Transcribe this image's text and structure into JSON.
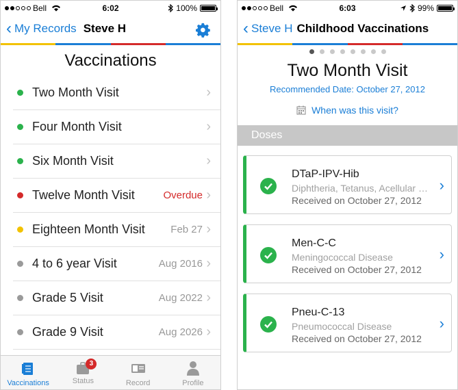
{
  "colors": {
    "accent": "#1a7ed6",
    "done": "#2bb24c",
    "overdue": "#d42a2a",
    "upcoming": "#f2c200",
    "future": "#9a9a9a",
    "stripe": [
      "#f2c200",
      "#1a7ed6",
      "#d42a2a",
      "#1a7ed6"
    ]
  },
  "left": {
    "status_bar": {
      "carrier": "Bell",
      "time": "6:02",
      "battery": "100%",
      "battery_level": 1.0
    },
    "nav": {
      "back_label": "My Records",
      "title": "Steve H",
      "settings_icon": "gear-icon"
    },
    "heading": "Vaccinations",
    "visits": [
      {
        "name": "Two Month Visit",
        "status": "",
        "state": "done"
      },
      {
        "name": "Four Month Visit",
        "status": "",
        "state": "done"
      },
      {
        "name": "Six Month Visit",
        "status": "",
        "state": "done"
      },
      {
        "name": "Twelve Month Visit",
        "status": "Overdue",
        "state": "overdue"
      },
      {
        "name": "Eighteen Month Visit",
        "status": "Feb 27",
        "state": "upcoming"
      },
      {
        "name": "4 to 6 year Visit",
        "status": "Aug 2016",
        "state": "future"
      },
      {
        "name": "Grade 5 Visit",
        "status": "Aug 2022",
        "state": "future"
      },
      {
        "name": "Grade 9 Visit",
        "status": "Aug 2026",
        "state": "future"
      }
    ],
    "tabs": [
      {
        "label": "Vaccinations",
        "icon": "vaccinations-icon",
        "active": true
      },
      {
        "label": "Status",
        "icon": "status-icon",
        "badge": "3"
      },
      {
        "label": "Record",
        "icon": "record-icon"
      },
      {
        "label": "Profile",
        "icon": "profile-icon"
      }
    ]
  },
  "right": {
    "status_bar": {
      "carrier": "Bell",
      "time": "6:03",
      "battery": "99%",
      "battery_level": 0.99
    },
    "nav": {
      "back_label": "Steve H",
      "title": "Childhood Vaccinations"
    },
    "pager": {
      "count": 8,
      "current": 1
    },
    "visit_title": "Two Month Visit",
    "recommended": "Recommended Date: October 27, 2012",
    "when_link": "When was this visit?",
    "doses_header": "Doses",
    "doses": [
      {
        "name": "DTaP-IPV-Hib",
        "description": "Diphtheria, Tetanus, Acellular Pertussis, Polio, Hib",
        "received": "Received on October 27, 2012"
      },
      {
        "name": "Men-C-C",
        "description": "Meningococcal Disease",
        "received": "Received on October 27, 2012"
      },
      {
        "name": "Pneu-C-13",
        "description": "Pneumococcal Disease",
        "received": "Received on October 27, 2012"
      }
    ]
  }
}
